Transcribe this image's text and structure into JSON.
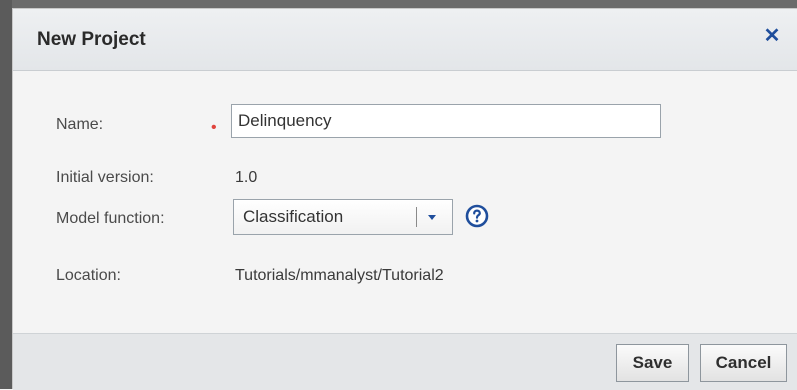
{
  "dialog": {
    "title": "New Project",
    "close_icon": "close-icon"
  },
  "form": {
    "name": {
      "label": "Name:",
      "required_marker": "•",
      "value": "Delinquency"
    },
    "initial_version": {
      "label": "Initial version:",
      "value": "1.0"
    },
    "model_function": {
      "label": "Model function:",
      "selected": "Classification",
      "dropdown_icon": "chevron-down-icon",
      "help_icon": "help-icon"
    },
    "location": {
      "label": "Location:",
      "value": "Tutorials/mmanalyst/Tutorial2"
    }
  },
  "footer": {
    "save_label": "Save",
    "cancel_label": "Cancel"
  },
  "colors": {
    "accent_blue": "#1f4e9c",
    "required_red": "#e0443d"
  }
}
